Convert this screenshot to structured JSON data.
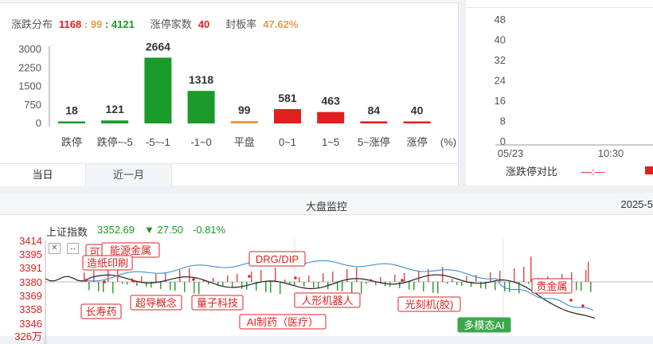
{
  "stats": {
    "dist_label": "涨跌分布",
    "up": "1168",
    "sep1": ":",
    "flat": "99",
    "sep2": ":",
    "down": "4121",
    "limit_label": "涨停家数",
    "limit_count": "40",
    "seal_label": "封板率",
    "seal_rate": "47.62%"
  },
  "chart_data": [
    {
      "type": "bar",
      "categories": [
        "跌停",
        "跌停~-5",
        "-5~-1",
        "-1~0",
        "平盘",
        "0~1",
        "1~5",
        "5~涨停",
        "涨停"
      ],
      "values": [
        18,
        121,
        2664,
        1318,
        99,
        581,
        463,
        84,
        40
      ],
      "value_labels": [
        "18",
        "121",
        "2664",
        "1318",
        "99",
        "581",
        "463",
        "84",
        "40"
      ],
      "yticks": [
        "3000",
        "2250",
        "1500",
        "750",
        "0"
      ],
      "ylim": [
        0,
        3000
      ],
      "unit_label": "(%)",
      "colors": [
        "#1a9a2a",
        "#1a9a2a",
        "#1a9a2a",
        "#1a9a2a",
        "#e89a4a",
        "#e02020",
        "#e02020",
        "#e02020",
        "#e02020"
      ]
    },
    {
      "type": "line",
      "yticks": [
        "48",
        "40",
        "32",
        "24",
        "16",
        "8",
        "0"
      ],
      "ylim": [
        0,
        48
      ],
      "xticks": [
        "05/23",
        "10:30"
      ],
      "legend_title": "涨跌停对比",
      "legend_sep": "—:—"
    },
    {
      "type": "line",
      "yticks": [
        "3414",
        "3395",
        "3391",
        "3380",
        "3369",
        "3358",
        "3346",
        "326万"
      ],
      "index_name": "上证指数",
      "index_value": "3352.69",
      "index_change": "▼ 27.50",
      "index_pct": "-0.81%"
    }
  ],
  "tabs": [
    "当日",
    "近一月"
  ],
  "monitor": {
    "title": "大盘监控",
    "date": "2025-5"
  },
  "events": {
    "e1": "可",
    "e2": "能源金属",
    "e3": "造纸印刷",
    "e4": "长寿药",
    "e5": "超导概念",
    "e6": "量子科技",
    "e7": "DRG/DIP",
    "e8": "AI制药（医疗）",
    "e9": "人形机器人",
    "e10": "光刻机(胶)",
    "e11": "多模态AI",
    "e12": "贵金属"
  },
  "icons": {
    "close": "close-icon",
    "expand": "expand-arrows-icon"
  }
}
